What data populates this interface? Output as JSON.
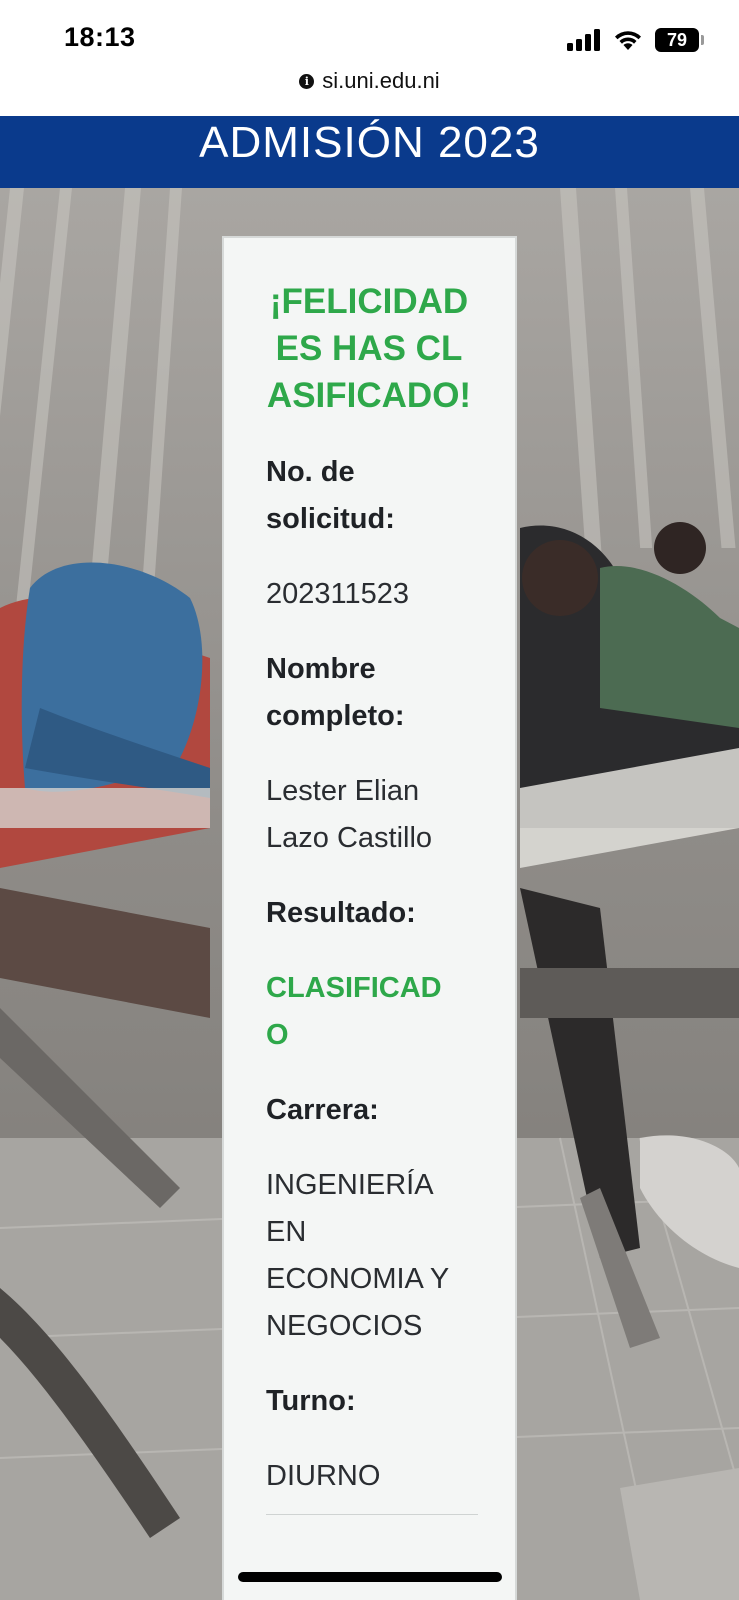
{
  "status_bar": {
    "time": "18:13",
    "battery": "79",
    "signal_icon": "cellular-signal-icon",
    "wifi_icon": "wifi-icon"
  },
  "browser": {
    "url": "si.uni.edu.ni",
    "info_icon": "info-icon"
  },
  "banner": {
    "title": "ADMISIÓN 2023",
    "color": "#0a3a8c"
  },
  "result_card": {
    "title": "¡FELICIDADES HAS CLASIFICADO!",
    "title_color": "#2ea84a",
    "fields": {
      "solicitud_label": "No. de solicitud:",
      "solicitud_value": "202311523",
      "nombre_label": "Nombre completo:",
      "nombre_value": "Lester Elian Lazo Castillo",
      "resultado_label": "Resultado:",
      "resultado_value": "CLASIFICADO",
      "carrera_label": "Carrera:",
      "carrera_value": "INGENIERÍA EN ECONOMIA Y NEGOCIOS",
      "turno_label": "Turno:",
      "turno_value": "DIURNO"
    }
  }
}
